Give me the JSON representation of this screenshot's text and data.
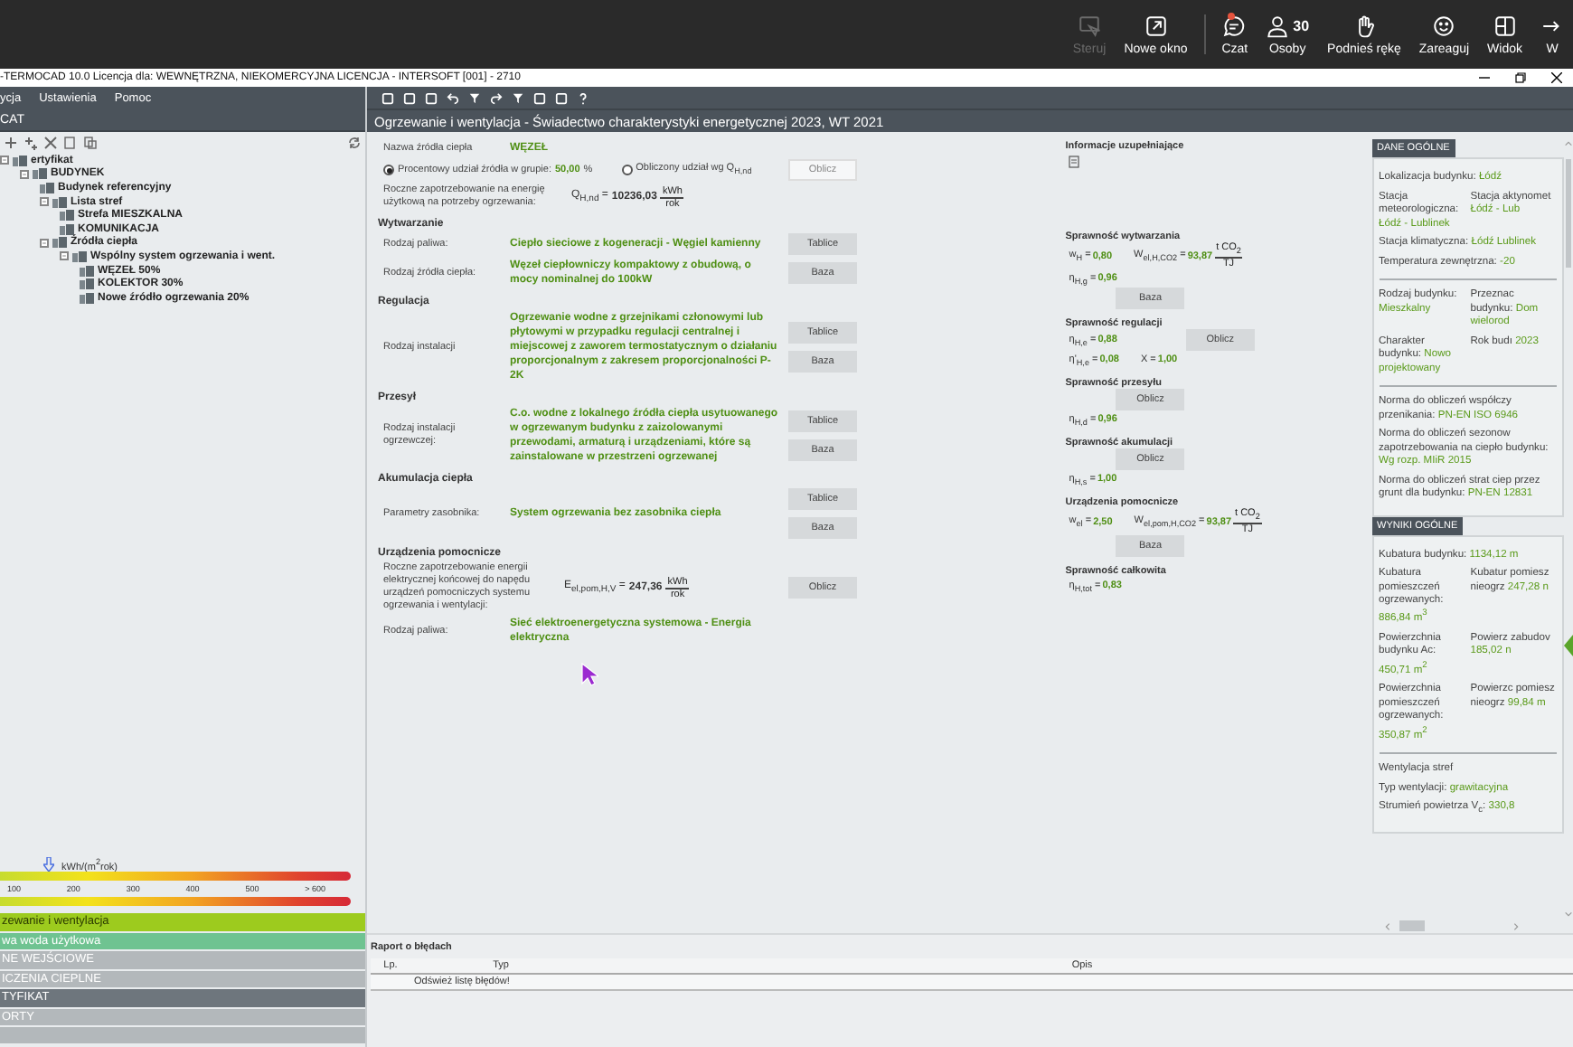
{
  "meeting_bar": {
    "buttons": [
      {
        "kind": "control",
        "label": "Steruj",
        "disabled": true,
        "notification": false
      },
      {
        "kind": "window",
        "label": "Nowe okno",
        "disabled": false,
        "notification": false
      },
      {
        "kind": "chat",
        "label": "Czat",
        "disabled": false,
        "notification": true
      },
      {
        "kind": "people",
        "label": "Osoby",
        "count": "30",
        "disabled": false,
        "notification": false
      },
      {
        "kind": "hand",
        "label": "Podnieś rękę",
        "disabled": false,
        "notification": false
      },
      {
        "kind": "smile",
        "label": "Zareaguj",
        "disabled": false,
        "notification": false
      },
      {
        "kind": "layout",
        "label": "Widok",
        "disabled": false,
        "notification": false
      },
      {
        "kind": "more",
        "label": "W",
        "disabled": false,
        "notification": false
      }
    ]
  },
  "window": {
    "title": "-TERMOCAD 10.0 Licencja dla: WEWNĘTRZNA, NIEKOMERCYJNA LICENCJA - INTERSOFT [001] - 2710"
  },
  "menu": [
    "ycja",
    "Ustawienia",
    "Pomoc"
  ],
  "left_header": "CAT",
  "tree": [
    {
      "label": "ertyfikat",
      "expanded": true,
      "children": [
        {
          "label": "BUDYNEK",
          "expanded": true,
          "children": [
            {
              "label": "Budynek referencyjny"
            },
            {
              "label": "Lista stref",
              "expanded": true,
              "children": [
                {
                  "label": "Strefa MIESZKALNA"
                },
                {
                  "label": "KOMUNIKACJA"
                }
              ]
            },
            {
              "label": "Źródła ciepła",
              "expanded": true,
              "children": [
                {
                  "label": "Wspólny system ogrzewania i went.",
                  "expanded": true,
                  "children": [
                    {
                      "label": "WĘZEŁ 50%"
                    },
                    {
                      "label": "KOLEKTOR 30%"
                    },
                    {
                      "label": "Nowe źródło ogrzewania 20%"
                    }
                  ]
                }
              ]
            }
          ]
        }
      ]
    }
  ],
  "energy_scale": {
    "unit": "kWh/(m$^{2}$rok)",
    "level": 0.12,
    "ticks": [
      "100",
      "200",
      "300",
      "400",
      "500",
      "> 600"
    ]
  },
  "nav": [
    {
      "label": "zewanie i wentylacja",
      "color": "#9dcb1e",
      "selected": true
    },
    {
      "label": "wa woda użytkowa",
      "color": "#6fc391",
      "selected": false
    },
    {
      "label": "NE WEJŚCIOWE",
      "color": "#b3b8bb",
      "selected": false
    },
    {
      "label": "ICZENIA CIEPLNE",
      "color": "#b3b8bb",
      "selected": false
    },
    {
      "label": "TYFIKAT",
      "color": "#6e767d",
      "selected": false
    },
    {
      "label": "ORTY",
      "color": "#b3b8bb",
      "selected": false
    }
  ],
  "main": {
    "title": "Ogrzewanie i wentylacja - Świadectwo charakterystyki energetycznej 2023, WT 2021"
  },
  "form": {
    "source_label": "Nazwa źródła ciepła",
    "source_value": "WĘZEŁ",
    "radios": [
      {
        "label": "Procentowy udział źródła w grupie:",
        "value": "50,00",
        "unit": "%",
        "selected": true
      },
      {
        "label": "Obliczony udział wg Q$_{H,nd}$",
        "selected": false
      }
    ],
    "share_button": {
      "label": "Oblicz",
      "disabled": true
    },
    "demand": {
      "label": "Roczne zapotrzebowanie na energię użytkową na potrzeby ogrzewania:",
      "symbol": "Q$_{H,nd}$ =",
      "value": "10236,03",
      "unit_num": "kWh",
      "unit_den": "rok"
    },
    "sections": [
      {
        "title": "Wytwarzanie",
        "rows": [
          {
            "label": "Rodzaj paliwa:",
            "value": "Ciepło sieciowe z kogeneracji - Węgiel kamienny",
            "buttons": [
              {
                "label": "Tablice",
                "disabled": false
              }
            ]
          },
          {
            "label": "Rodzaj źródła ciepła:",
            "value": "Węzeł ciepłowniczy kompaktowy z obudową, o mocy nominalnej do 100kW",
            "buttons": [
              {
                "label": "Baza",
                "disabled": false
              }
            ]
          }
        ]
      },
      {
        "title": "Regulacja",
        "rows": [
          {
            "label": "Rodzaj instalacji",
            "value": "Ogrzewanie wodne z grzejnikami członowymi lub płytowymi w przypadku regulacji centralnej i miejscowej z zaworem termostatycznym o działaniu proporcjonalnym z zakresem proporcjonalności P-2K",
            "buttons": [
              {
                "label": "Tablice",
                "disabled": false
              },
              {
                "label": "Baza",
                "disabled": false
              }
            ]
          }
        ]
      },
      {
        "title": "Przesył",
        "rows": [
          {
            "label": "Rodzaj instalacji ogrzewczej:",
            "value": "C.o. wodne z lokalnego źródła ciepła usytuowanego w ogrzewanym budynku z zaizolowanymi przewodami, armaturą i urządzeniami, które są zainstalowane w przestrzeni ogrzewanej",
            "buttons": [
              {
                "label": "Tablice",
                "disabled": false
              },
              {
                "label": "Baza",
                "disabled": false
              }
            ]
          }
        ]
      },
      {
        "title": "Akumulacja ciepła",
        "rows": [
          {
            "label": "Parametry zasobnika:",
            "value": "System ogrzewania bez zasobnika ciepła",
            "buttons": [
              {
                "label": "Tablice",
                "disabled": false
              },
              {
                "label": "Baza",
                "disabled": false
              }
            ]
          }
        ]
      }
    ],
    "auxiliary": {
      "title": "Urządzenia pomocnicze",
      "label": "Roczne zapotrzebowanie energii elektrycznej końcowej do napędu urządzeń pomocniczych systemu ogrzewania i wentylacji:",
      "symbol": "E$_{el,pom,H,V}$ =",
      "value": "247,36",
      "unit_num": "kWh",
      "unit_den": "rok",
      "button": {
        "label": "Oblicz",
        "disabled": false
      },
      "fuel_label": "Rodzaj paliwa:",
      "fuel_value": "Sieć elektroenergetyczna systemowa - Energia elektryczna"
    }
  },
  "info": {
    "title": "Informacje uzupełniające",
    "sections": [
      {
        "title": "Sprawność wytwarzania",
        "rows": [
          {
            "terms": [
              {
                "symbol": "w$_{H}$ =",
                "value": "0,80"
              },
              {
                "symbol": "W$_{el,H,CO2}$ =",
                "value": "93,87",
                "unit_num": "t CO$_{2}$",
                "unit_den": "TJ"
              }
            ]
          },
          {
            "terms": [
              {
                "symbol": "η$_{H,g}$ =",
                "value": "0,96"
              }
            ]
          },
          {
            "button": {
              "label": "Baza",
              "disabled": false
            }
          }
        ]
      },
      {
        "title": "Sprawność regulacji",
        "rows": [
          {
            "terms": [
              {
                "symbol": "η$_{H,e}$ =",
                "value": "0,88"
              }
            ],
            "button": {
              "label": "Oblicz",
              "disabled": false
            }
          },
          {
            "terms": [
              {
                "symbol": "η'$_{H,e}$ =",
                "value": "0,08"
              },
              {
                "symbol": "X =",
                "value": "1,00"
              }
            ]
          }
        ]
      },
      {
        "title": "Sprawność przesyłu",
        "rows": [
          {
            "button": {
              "label": "Oblicz",
              "disabled": false
            }
          },
          {
            "terms": [
              {
                "symbol": "η$_{H,d}$ =",
                "value": "0,96"
              }
            ]
          }
        ]
      },
      {
        "title": "Sprawność akumulacji",
        "rows": [
          {
            "button": {
              "label": "Oblicz",
              "disabled": false
            }
          },
          {
            "terms": [
              {
                "symbol": "η$_{H,s}$ =",
                "value": "1,00"
              }
            ]
          }
        ]
      },
      {
        "title": "Urządzenia pomocnicze",
        "rows": [
          {
            "terms": [
              {
                "symbol": "w$_{el}$ =",
                "value": "2,50"
              },
              {
                "symbol": "W$_{el,pom,H,CO2}$ =",
                "value": "93,87",
                "unit_num": "t CO$_{2}$",
                "unit_den": "TJ"
              }
            ]
          },
          {
            "button": {
              "label": "Baza",
              "disabled": false
            }
          }
        ]
      },
      {
        "title": "Sprawność całkowita",
        "rows": [
          {
            "terms": [
              {
                "symbol": "η$_{H,tot}$ =",
                "value": "0,83"
              }
            ]
          }
        ]
      }
    ]
  },
  "side_panel": {
    "sections": [
      {
        "title": "DANE OGÓLNE",
        "groups": [
          [
            [
              {
                "label": "Lokalizacja budynku:",
                "value": "Łódź"
              }
            ],
            [
              {
                "label": "Stacja meteorologiczna:",
                "value": "Łódź - Lublinek"
              },
              {
                "label": "Stacja aktynomet",
                "value": "Łódź - Lub"
              }
            ],
            [
              {
                "label": "Stacja klimatyczna:",
                "value": "Łódź Lublinek"
              }
            ],
            [
              {
                "label": "Temperatura zewnętrzna:",
                "value": "-20"
              }
            ]
          ],
          [
            [
              {
                "label": "Rodzaj budynku:",
                "value": "Mieszkalny"
              },
              {
                "label": "Przeznac budynku:",
                "value": "Dom wielorod"
              }
            ],
            [
              {
                "label": "Charakter budynku:",
                "value": "Nowo projektowany"
              },
              {
                "label": "Rok budı",
                "value": "2023"
              }
            ]
          ],
          [
            [
              {
                "label": "Norma do obliczeń współczy przenikania:",
                "value": "PN-EN ISO 6946"
              }
            ],
            [
              {
                "label": "Norma do obliczeń sezonow zapotrzebowania na ciepło budynku:",
                "value": "Wg rozp. MIiR 2015"
              }
            ],
            [
              {
                "label": "Norma do obliczeń strat ciep przez grunt dla budynku:",
                "value": "PN-EN 12831"
              }
            ]
          ]
        ]
      },
      {
        "title": "WYNIKI OGÓLNE",
        "groups": [
          [
            [
              {
                "label": "Kubatura budynku:",
                "value": "1134,12 m"
              }
            ],
            [
              {
                "label": "Kubatura pomieszczeń ogrzewanych:",
                "value": "886,84 m$^{3}$"
              },
              {
                "label": "Kubatur pomiesz nieogrz",
                "value": "247,28 n"
              }
            ],
            [
              {
                "label": "Powierzchnia budynku Ac:",
                "value": "450,71 m$^{2}$"
              },
              {
                "label": "Powierz zabudov",
                "value": "185,02 n"
              }
            ],
            [
              {
                "label": "Powierzchnia pomieszczeń ogrzewanych:",
                "value": "350,87 m$^{2}$"
              },
              {
                "label": "Powierzc pomiesz nieogrz",
                "value": "99,84 m"
              }
            ]
          ],
          [
            [
              {
                "label": "Wentylacja stref"
              }
            ],
            [
              {
                "label": "Typ wentylacji:",
                "value": "grawitacyjna"
              }
            ],
            [
              {
                "label": "Strumień powietrza V$_{c}$:",
                "value": "330,8"
              }
            ]
          ]
        ]
      }
    ]
  },
  "error_report": {
    "title": "Raport o błędach",
    "columns": [
      "Lp.",
      "Typ",
      "Opis"
    ],
    "rows": [
      [
        "",
        "Odśwież listę błędów!",
        ""
      ]
    ]
  }
}
